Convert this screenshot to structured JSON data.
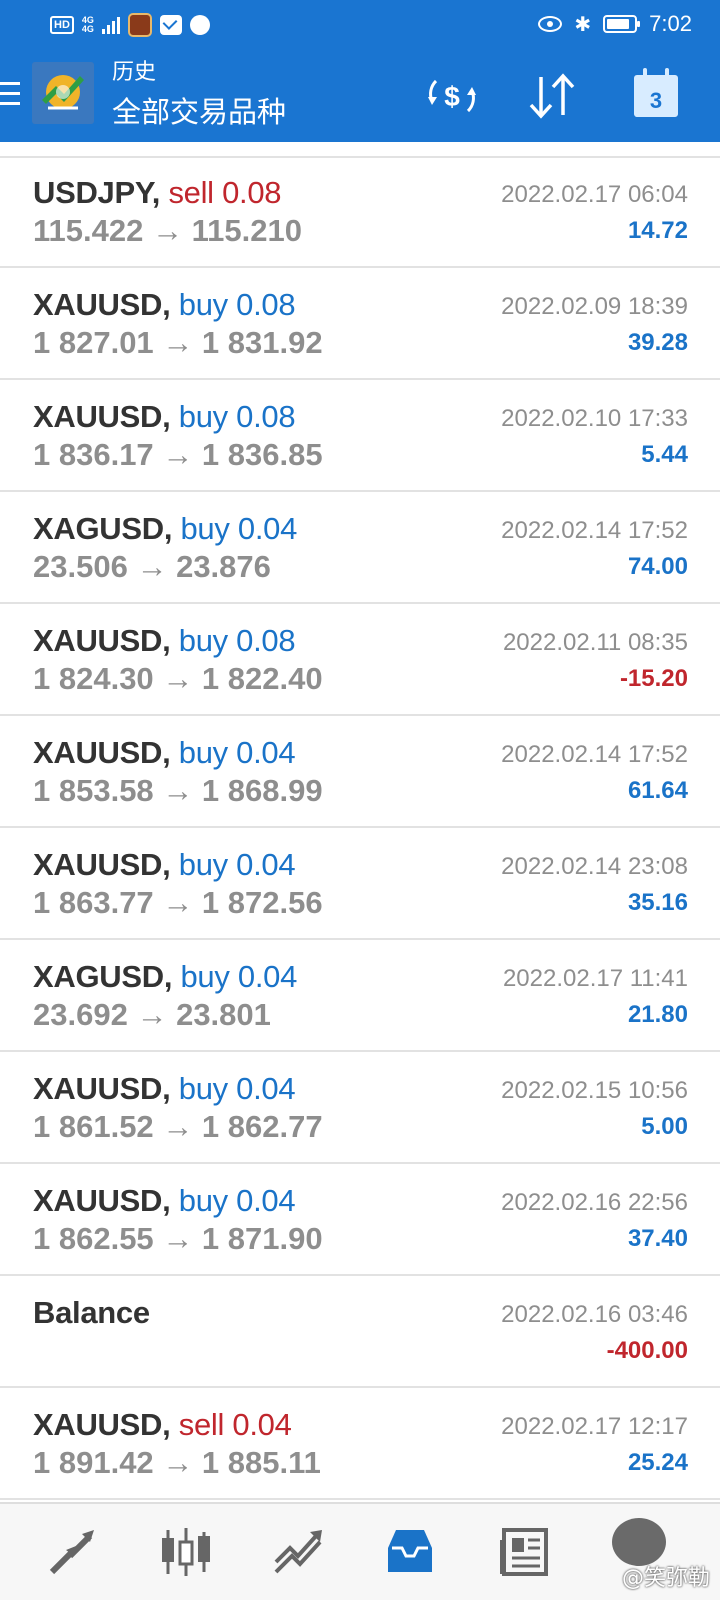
{
  "status_bar": {
    "hd": "HD",
    "network_top": "4G",
    "network_bottom": "4G",
    "time": "7:02"
  },
  "toolbar": {
    "title": "历史",
    "subtitle": "全部交易品种",
    "calendar_day": "3"
  },
  "trades": [
    {
      "symbol": "USDJPY,",
      "side": "sell",
      "volume": "0.08",
      "open_price": "115.422",
      "close_price": "115.210",
      "arrow": "→",
      "datetime": "2022.02.17 06:04",
      "profit": "14.72"
    },
    {
      "symbol": "XAUUSD,",
      "side": "buy",
      "volume": "0.08",
      "open_price": "1 827.01",
      "close_price": "1 831.92",
      "arrow": "→",
      "datetime": "2022.02.09 18:39",
      "profit": "39.28"
    },
    {
      "symbol": "XAUUSD,",
      "side": "buy",
      "volume": "0.08",
      "open_price": "1 836.17",
      "close_price": "1 836.85",
      "arrow": "→",
      "datetime": "2022.02.10 17:33",
      "profit": "5.44"
    },
    {
      "symbol": "XAGUSD,",
      "side": "buy",
      "volume": "0.04",
      "open_price": "23.506",
      "close_price": "23.876",
      "arrow": "→",
      "datetime": "2022.02.14 17:52",
      "profit": "74.00"
    },
    {
      "symbol": "XAUUSD,",
      "side": "buy",
      "volume": "0.08",
      "open_price": "1 824.30",
      "close_price": "1 822.40",
      "arrow": "→",
      "datetime": "2022.02.11 08:35",
      "profit": "-15.20"
    },
    {
      "symbol": "XAUUSD,",
      "side": "buy",
      "volume": "0.04",
      "open_price": "1 853.58",
      "close_price": "1 868.99",
      "arrow": "→",
      "datetime": "2022.02.14 17:52",
      "profit": "61.64"
    },
    {
      "symbol": "XAUUSD,",
      "side": "buy",
      "volume": "0.04",
      "open_price": "1 863.77",
      "close_price": "1 872.56",
      "arrow": "→",
      "datetime": "2022.02.14 23:08",
      "profit": "35.16"
    },
    {
      "symbol": "XAGUSD,",
      "side": "buy",
      "volume": "0.04",
      "open_price": "23.692",
      "close_price": "23.801",
      "arrow": "→",
      "datetime": "2022.02.17 11:41",
      "profit": "21.80"
    },
    {
      "symbol": "XAUUSD,",
      "side": "buy",
      "volume": "0.04",
      "open_price": "1 861.52",
      "close_price": "1 862.77",
      "arrow": "→",
      "datetime": "2022.02.15 10:56",
      "profit": "5.00"
    },
    {
      "symbol": "XAUUSD,",
      "side": "buy",
      "volume": "0.04",
      "open_price": "1 862.55",
      "close_price": "1 871.90",
      "arrow": "→",
      "datetime": "2022.02.16 22:56",
      "profit": "37.40"
    },
    {
      "symbol": "Balance",
      "side": "",
      "volume": "",
      "open_price": "",
      "close_price": "",
      "arrow": "",
      "datetime": "2022.02.16 03:46",
      "profit": "-400.00"
    },
    {
      "symbol": "XAUUSD,",
      "side": "sell",
      "volume": "0.04",
      "open_price": "1 891.42",
      "close_price": "1 885.11",
      "arrow": "→",
      "datetime": "2022.02.17 12:17",
      "profit": "25.24"
    }
  ],
  "bottom_nav": {
    "items": [
      {
        "icon": "quotes-icon",
        "active": false
      },
      {
        "icon": "chart-icon",
        "active": false
      },
      {
        "icon": "trade-icon",
        "active": false
      },
      {
        "icon": "history-icon",
        "active": true
      },
      {
        "icon": "news-icon",
        "active": false
      }
    ],
    "watermark": "@笑弥勒"
  },
  "colors": {
    "header": "#1a75d1",
    "buy": "#1a73c8",
    "sell": "#c0262d",
    "muted": "#8e8e8e",
    "active_nav": "#1a73c8"
  }
}
